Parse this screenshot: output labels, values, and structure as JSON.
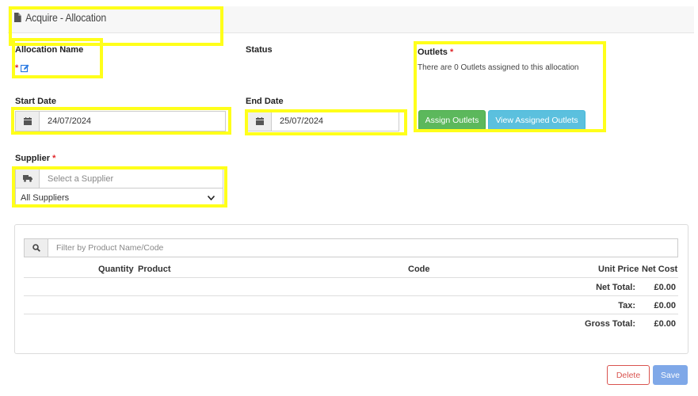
{
  "header": {
    "title": "Acquire - Allocation",
    "icon": "document-icon"
  },
  "allocation_name": {
    "label": "Allocation Name",
    "required_mark": "*",
    "edit_icon": "edit-icon"
  },
  "status": {
    "label": "Status"
  },
  "outlets": {
    "label": "Outlets",
    "required_mark": "*",
    "message": "There are 0 Outlets assigned to this allocation",
    "assign_button": "Assign Outlets",
    "view_button": "View Assigned Outlets"
  },
  "start_date": {
    "label": "Start Date",
    "value": "24/07/2024",
    "icon": "calendar-icon"
  },
  "end_date": {
    "label": "End Date",
    "value": "25/07/2024",
    "icon": "calendar-icon"
  },
  "supplier": {
    "label": "Supplier",
    "required_mark": "*",
    "search_placeholder": "Select a Supplier",
    "icon": "truck-icon",
    "selected": "All Suppliers"
  },
  "products": {
    "filter_placeholder": "Filter by Product Name/Code",
    "filter_icon": "search-icon",
    "columns": {
      "quantity": "Quantity",
      "product": "Product",
      "code": "Code",
      "unit_price": "Unit Price",
      "net_cost": "Net Cost"
    },
    "totals": [
      {
        "label": "Net Total:",
        "value": "£0.00"
      },
      {
        "label": "Tax:",
        "value": "£0.00"
      },
      {
        "label": "Gross Total:",
        "value": "£0.00"
      }
    ]
  },
  "actions": {
    "delete": "Delete",
    "save": "Save"
  },
  "colors": {
    "highlight": "#ffff1a",
    "required": "#e0262a",
    "assign": "#5cb85c",
    "view": "#5bc0de",
    "delete": "#d9534f",
    "save": "#7fa8e8"
  }
}
